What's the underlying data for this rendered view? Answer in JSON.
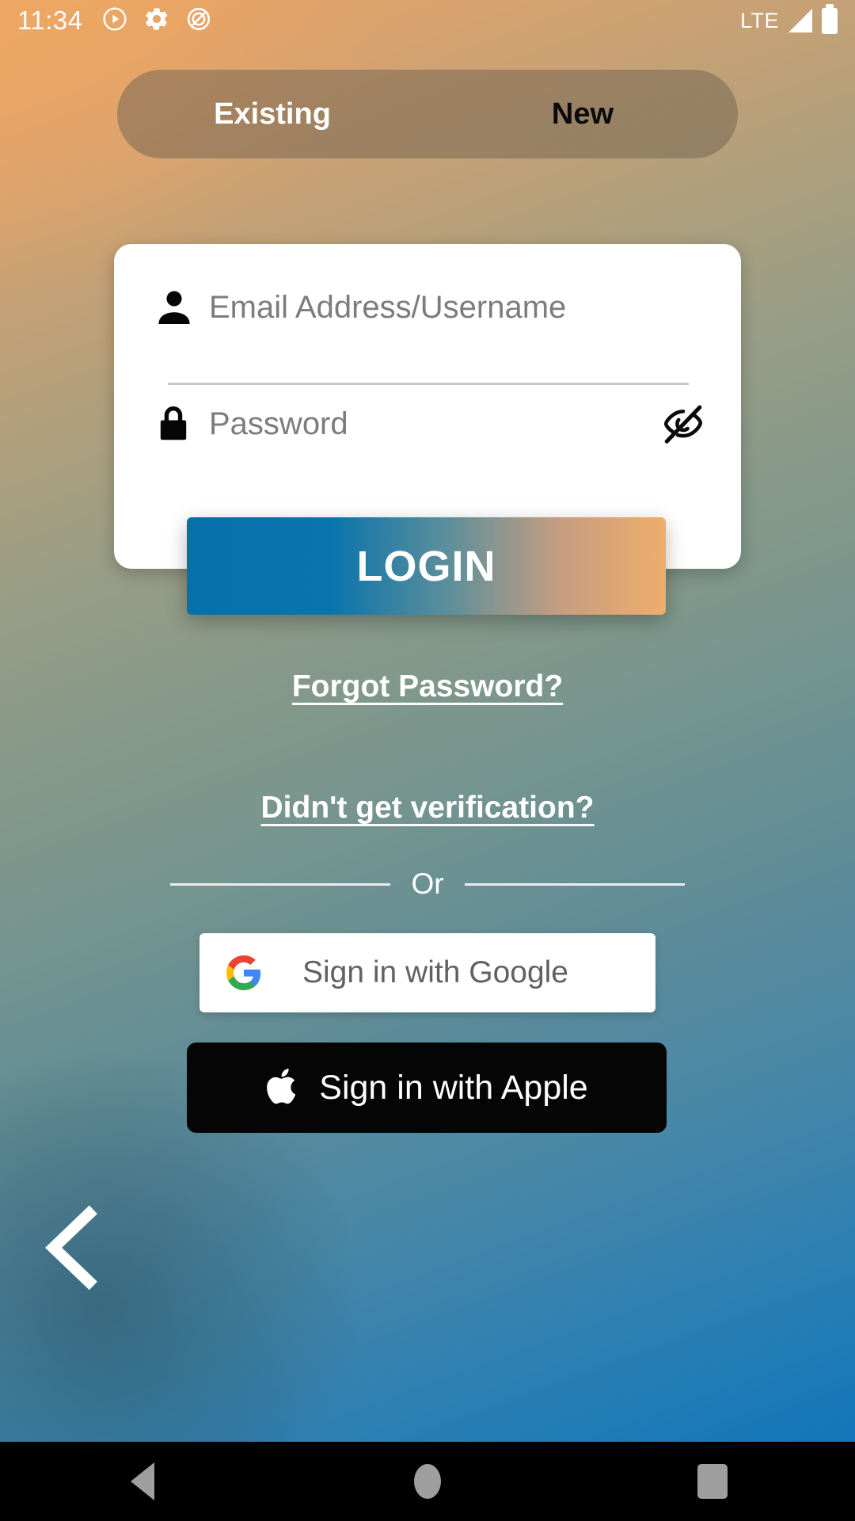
{
  "status_bar": {
    "time": "11:34",
    "icons": [
      "play-circle-icon",
      "gear-icon",
      "do-not-disturb-icon"
    ],
    "network_label": "LTE",
    "signal_icon": "signal-bars-icon",
    "battery_icon": "battery-full-icon"
  },
  "segmented_control": {
    "options": [
      {
        "label": "Existing",
        "state": "active"
      },
      {
        "label": "New",
        "state": "inactive"
      }
    ]
  },
  "form": {
    "username": {
      "icon": "person-icon",
      "value": "",
      "placeholder": "Email Address/Username"
    },
    "password": {
      "icon": "lock-icon",
      "value": "",
      "placeholder": "Password",
      "visibility_toggle_icon": "eye-off-icon"
    }
  },
  "login_button": {
    "label": "LOGIN",
    "gradient_start": "#0670ab",
    "gradient_end": "#eeae6b"
  },
  "links": {
    "forgot_password": "Forgot Password?",
    "didnt_get_verification": "Didn't get verification?"
  },
  "divider": {
    "text": "Or"
  },
  "social": {
    "google": {
      "label": "Sign in with Google",
      "icon": "google-g-icon"
    },
    "apple": {
      "label": "Sign in with Apple",
      "icon": "apple-logo-icon"
    }
  },
  "back_button": {
    "icon": "chevron-left-icon"
  },
  "nav_bar": {
    "back": "nav-back-icon",
    "home": "nav-home-icon",
    "recents": "nav-recents-icon"
  }
}
